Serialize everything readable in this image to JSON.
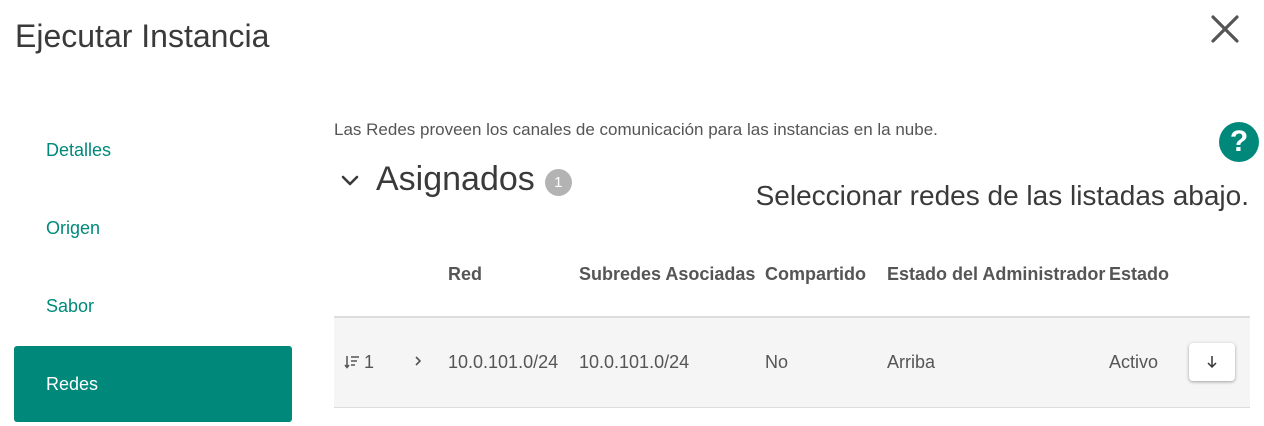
{
  "dialog": {
    "title": "Ejecutar Instancia"
  },
  "sidebar": {
    "items": [
      {
        "label": "Detalles"
      },
      {
        "label": "Origen"
      },
      {
        "label": "Sabor"
      },
      {
        "label": "Redes"
      }
    ],
    "active": "Redes"
  },
  "help": {
    "label": "?"
  },
  "networks": {
    "description": "Las Redes proveen los canales de comunicación para las instancias en la nube.",
    "section_title": "Asignados",
    "assigned_count": "1",
    "hint": "Seleccionar redes de las listadas abajo.",
    "columns": {
      "red": "Red",
      "subredes": "Subredes Asociadas",
      "compartido": "Compartido",
      "admin": "Estado del Administrador",
      "estado": "Estado"
    },
    "rows": [
      {
        "order": "1",
        "red": "10.0.101.0/24",
        "subredes": "10.0.101.0/24",
        "compartido": "No",
        "admin": "Arriba",
        "estado": "Activo"
      }
    ]
  },
  "colors": {
    "accent": "#00897b",
    "badge": "#b3b3b3"
  },
  "icons": [
    "close-icon",
    "help-icon",
    "chevron-down-icon",
    "sort-order-icon",
    "chevron-right-icon",
    "arrow-down-icon"
  ]
}
